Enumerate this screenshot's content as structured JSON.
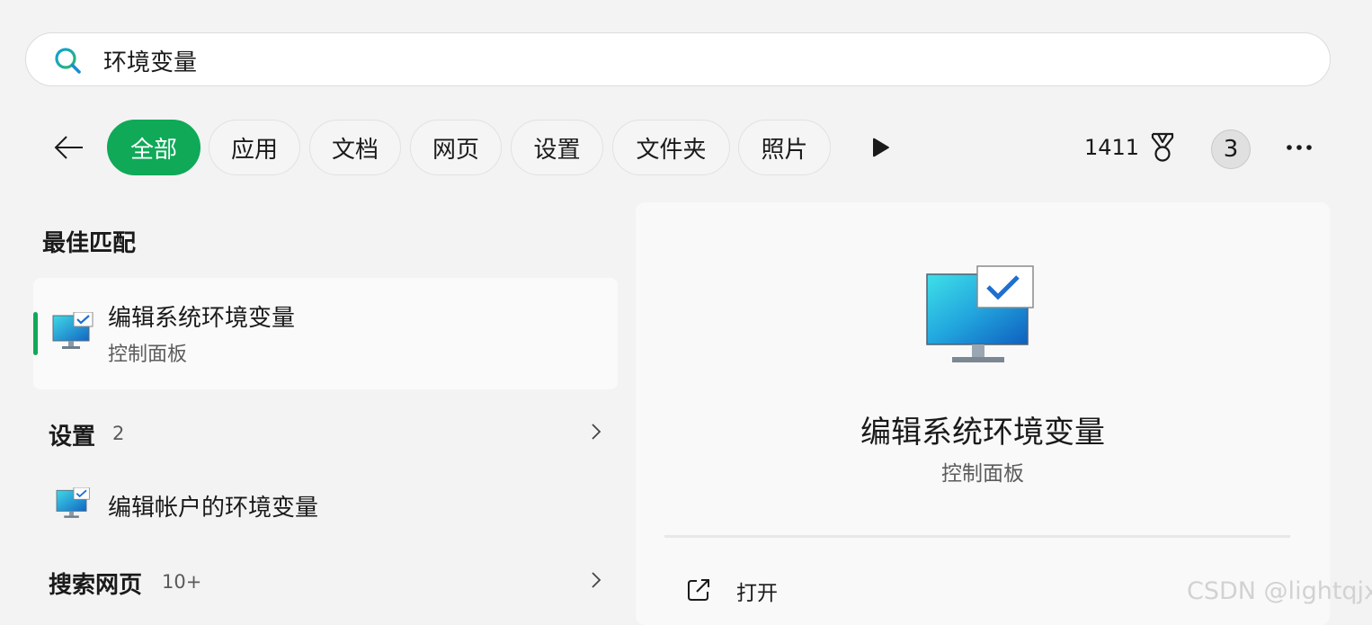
{
  "search": {
    "value": "环境变量",
    "placeholder": ""
  },
  "filters": [
    {
      "label": "全部",
      "active": true
    },
    {
      "label": "应用",
      "active": false
    },
    {
      "label": "文档",
      "active": false
    },
    {
      "label": "网页",
      "active": false
    },
    {
      "label": "设置",
      "active": false
    },
    {
      "label": "文件夹",
      "active": false
    },
    {
      "label": "照片",
      "active": false
    }
  ],
  "toolbar": {
    "points": "1411",
    "badge_count": "3",
    "icons": [
      "back-arrow-icon",
      "play-icon",
      "medal-icon",
      "more-icon"
    ]
  },
  "results": {
    "best_match": {
      "heading": "最佳匹配",
      "item": {
        "title": "编辑系统环境变量",
        "subtitle": "控制面板",
        "icon": "monitor-check-icon"
      }
    },
    "settings": {
      "heading": "设置",
      "count": "2",
      "items": [
        {
          "title": "编辑帐户的环境变量",
          "icon": "monitor-check-icon"
        }
      ]
    },
    "web": {
      "heading": "搜索网页",
      "count": "10+"
    }
  },
  "detail": {
    "title": "编辑系统环境变量",
    "subtitle": "控制面板",
    "action_label": "打开"
  },
  "watermark": "CSDN @lightqjx",
  "colors": {
    "accent": "#0fa958",
    "background": "#f3f3f3",
    "panel": "#f9f9f9"
  }
}
